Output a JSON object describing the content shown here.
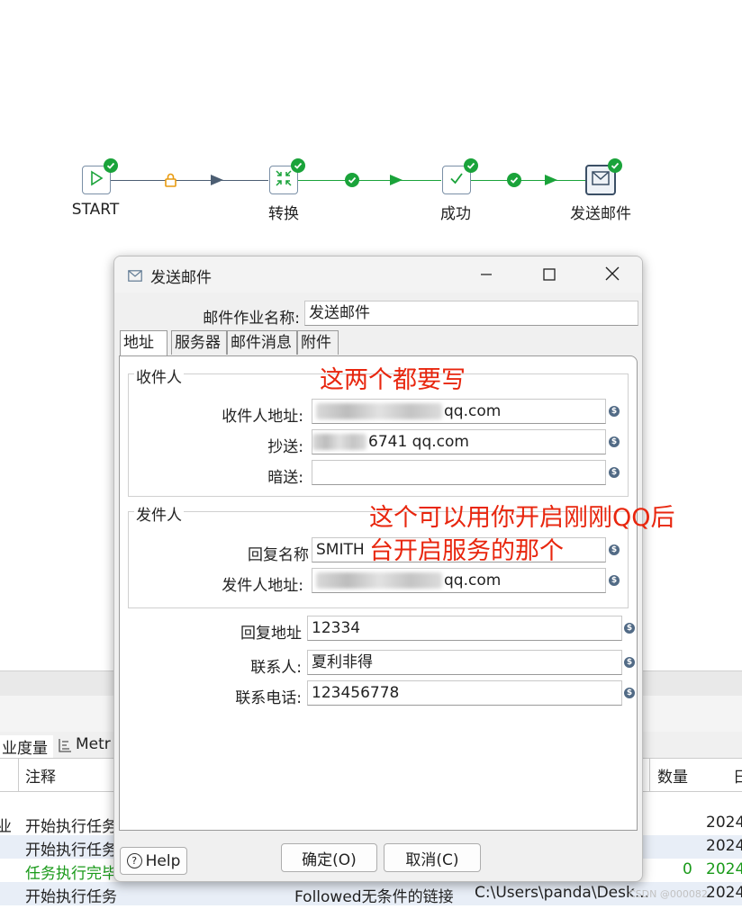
{
  "canvas": {
    "nodes": [
      {
        "label": "START",
        "icon": "play-icon"
      },
      {
        "label": "转换",
        "icon": "transform-icon"
      },
      {
        "label": "成功",
        "icon": "success-icon"
      },
      {
        "label": "发送邮件",
        "icon": "mail-icon"
      }
    ]
  },
  "background": {
    "tabs": [
      "业度量",
      "Metr"
    ],
    "header": {
      "col_note": "注释",
      "col_count": "数量",
      "col_date": "日"
    },
    "rows": [
      {
        "prefix": "业",
        "note": "开始执行任务",
        "count": "",
        "date": "2024",
        "color": "#222222"
      },
      {
        "prefix": "",
        "note": "开始执行任务",
        "count": "",
        "date": "2024",
        "color": "#222222"
      },
      {
        "prefix": "",
        "note": "任务执行完毕",
        "count": "0",
        "date": "2024",
        "color": "#1a9a1a"
      },
      {
        "prefix": "",
        "note": "开始执行任务",
        "reason": "Followed无条件的链接",
        "path": "C:\\Users\\panda\\Desk...",
        "date": "2024",
        "color": "#222222"
      }
    ],
    "watermark": "CSDN @000082"
  },
  "dialog": {
    "title": "发送邮件",
    "job_name_label": "邮件作业名称:",
    "job_name_value": "发送邮件",
    "tabs": [
      "地址",
      "服务器",
      "邮件消息",
      "附件"
    ],
    "recipients": {
      "title": "收件人",
      "to_label": "收件人地址:",
      "to_value": "qq.com",
      "cc_label": "抄送:",
      "cc_value": "6741  qq.com",
      "bcc_label": "暗送:",
      "bcc_value": ""
    },
    "sender": {
      "title": "发件人",
      "reply_name_label": "回复名称",
      "reply_name_value": "SMITH",
      "from_label": "发件人地址:",
      "from_value": "qq.com"
    },
    "reply_to_label": "回复地址",
    "reply_to_value": "12334",
    "contact_label": "联系人:",
    "contact_value": "夏利非得",
    "phone_label": "联系电话:",
    "phone_value": "123456778",
    "help_label": "Help",
    "ok_label": "确定(O)",
    "cancel_label": "取消(C)"
  },
  "annotations": {
    "a1": "这两个都要写",
    "a2_line1": "这个可以用你开启刚刚QQ后",
    "a2_line2": "台开启服务的那个"
  },
  "colors": {
    "accent_green": "#1aa33a",
    "annotation_red": "#e8260e",
    "hop_gray": "#4c5e73"
  }
}
